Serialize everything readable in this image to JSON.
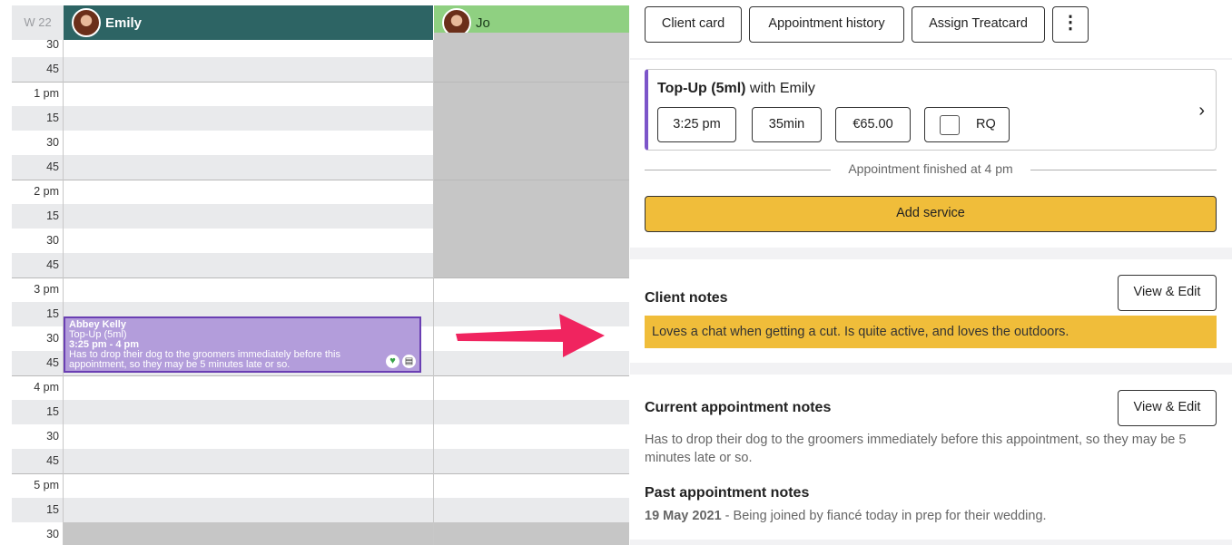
{
  "calendar": {
    "week_label": "W 22",
    "staff": [
      {
        "name": "Emily"
      },
      {
        "name": "Jo"
      }
    ],
    "time_labels": [
      "30",
      "45",
      "1 pm",
      "15",
      "30",
      "45",
      "2 pm",
      "15",
      "30",
      "45",
      "3 pm",
      "15",
      "30",
      "45",
      "4 pm",
      "15",
      "30",
      "45",
      "5 pm",
      "15",
      "30"
    ],
    "appointment": {
      "client": "Abbey Kelly",
      "service": "Top-Up (5ml)",
      "time": "3:25 pm - 4 pm",
      "note": "Has to drop their dog to the groomers immediately before this appointment, so they may be 5 minutes late or so.",
      "status_icon": "heart-icon",
      "notes_icon": "clipboard-icon"
    }
  },
  "panel": {
    "buttons": {
      "client_card": "Client card",
      "history": "Appointment history",
      "treatcard": "Assign Treatcard",
      "more_icon": "more-vertical-icon"
    },
    "service": {
      "name": "Top-Up (5ml)",
      "with": "with Emily",
      "time": "3:25 pm",
      "duration": "35min",
      "price": "€65.00",
      "rq": "RQ"
    },
    "finished_text": "Appointment finished at 4 pm",
    "add_service": "Add service",
    "client_notes": {
      "title": "Client notes",
      "edit": "View & Edit",
      "text": "Loves a chat when getting a cut. Is quite active, and loves the outdoors."
    },
    "current_notes": {
      "title": "Current appointment notes",
      "edit": "View & Edit",
      "text": "Has to drop their dog to the groomers immediately before this appointment, so they may be 5 minutes late or so."
    },
    "past_notes": {
      "title": "Past appointment notes",
      "date": "19 May 2021",
      "text": " - Being joined by fiancé today in prep for their wedding."
    }
  },
  "colors": {
    "emily_header": "#2d6464",
    "jo_header": "#8fd081",
    "appointment": "#b39ddb",
    "accent_yellow": "#f0bd3a",
    "arrow": "#f0245f"
  }
}
